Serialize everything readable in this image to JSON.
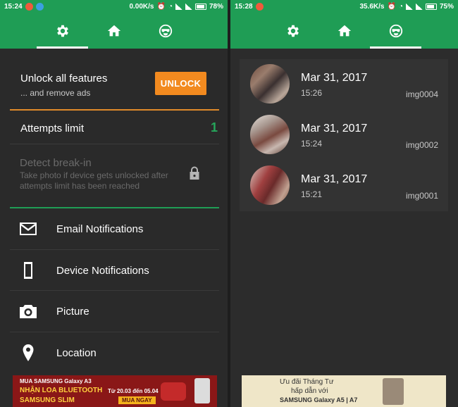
{
  "left": {
    "status": {
      "time": "15:24",
      "speed": "0.00K/s",
      "battery": "78%",
      "battery_level": 0.78
    },
    "tabs": [
      {
        "name": "settings",
        "icon": "gear-icon",
        "active": true
      },
      {
        "name": "home",
        "icon": "home-icon",
        "active": false
      },
      {
        "name": "intruders",
        "icon": "face-icon",
        "active": false
      }
    ],
    "unlock": {
      "title": "Unlock all features",
      "subtitle": "... and remove ads",
      "button": "UNLOCK"
    },
    "attempts": {
      "label": "Attempts limit",
      "value": "1"
    },
    "detect": {
      "label": "Detect break-in",
      "subtitle": "Take photo if device gets unlocked after attempts limit has been reached"
    },
    "menu": [
      {
        "label": "Email Notifications",
        "icon": "mail-icon"
      },
      {
        "label": "Device Notifications",
        "icon": "phone-icon"
      },
      {
        "label": "Picture",
        "icon": "camera-icon"
      },
      {
        "label": "Location",
        "icon": "location-pin-icon"
      }
    ],
    "ad": {
      "line1": "MUA SAMSUNG Galaxy A3",
      "line2": "NHẬN LOA BLUETOOTH",
      "line3": "SAMSUNG SLIM",
      "line4": "Từ 20.03 đến 05.04",
      "cta": "MUA NGAY"
    }
  },
  "right": {
    "status": {
      "time": "15:28",
      "speed": "35.6K/s",
      "battery": "75%",
      "battery_level": 0.75
    },
    "photos": [
      {
        "date": "Mar 31, 2017",
        "time": "15:26",
        "name": "img0004"
      },
      {
        "date": "Mar 31, 2017",
        "time": "15:24",
        "name": "img0002"
      },
      {
        "date": "Mar 31, 2017",
        "time": "15:21",
        "name": "img0001"
      }
    ],
    "ad": {
      "line1": "Ưu đãi Tháng Tư",
      "line2": "hấp dẫn với",
      "line3": "SAMSUNG Galaxy A5 | A7"
    }
  },
  "colors": {
    "accent": "#1f9d55",
    "orange": "#f28a1f",
    "bg": "#2a2a2a"
  }
}
